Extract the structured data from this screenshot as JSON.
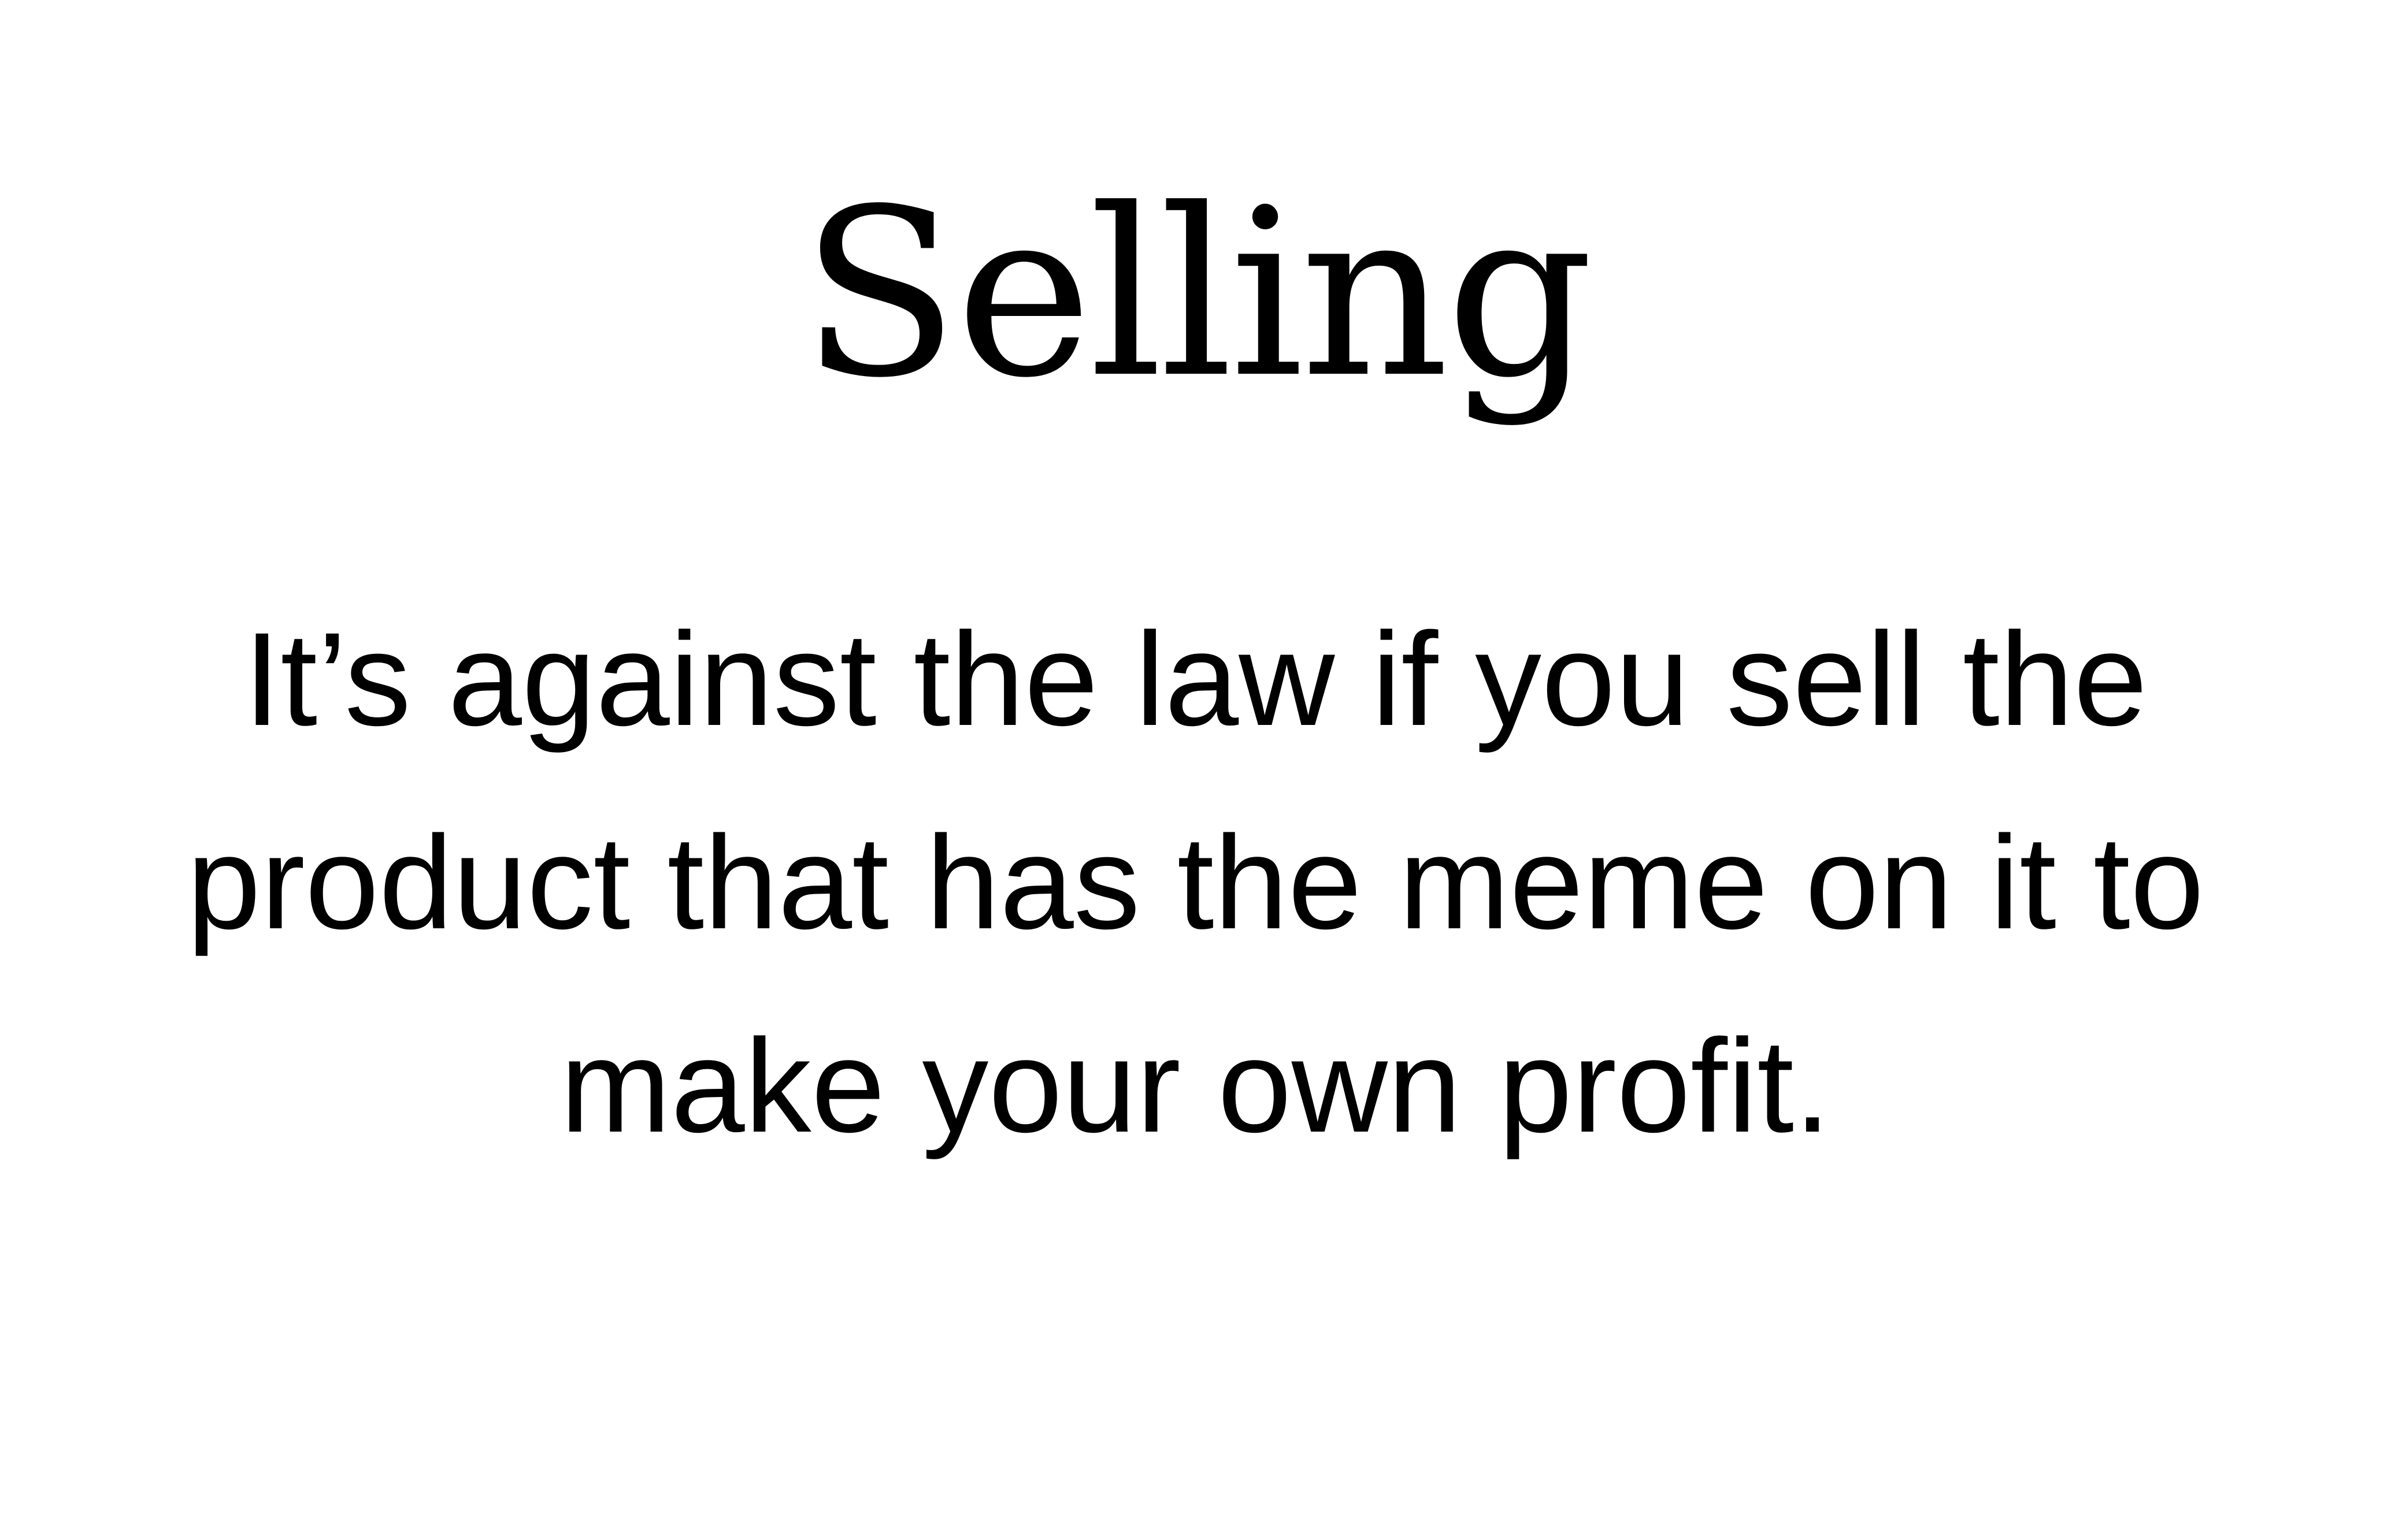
{
  "slide": {
    "title": "Selling",
    "body_lines": [
      "It’s against the law if you sell the",
      "product that has the meme on it to",
      "make your own profit."
    ]
  }
}
